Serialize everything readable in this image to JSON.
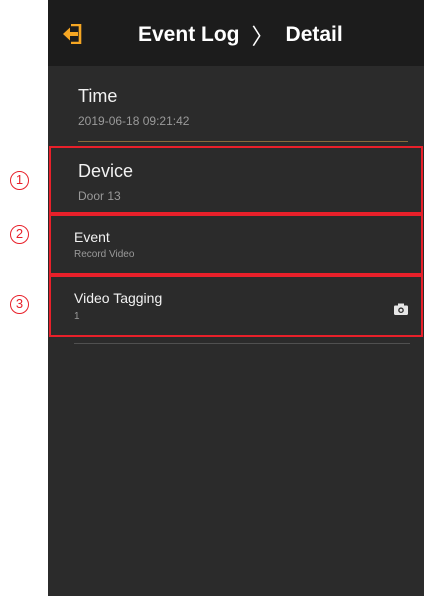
{
  "header": {
    "title": "Event Log",
    "separator": "〉",
    "subtitle": "Detail"
  },
  "fields": {
    "time": {
      "label": "Time",
      "value": "2019-06-18 09:21:42"
    },
    "device": {
      "label": "Device",
      "value": "Door 13"
    },
    "event": {
      "label": "Event",
      "value": "Record Video"
    },
    "video_tagging": {
      "label": "Video Tagging",
      "value": "1"
    }
  },
  "callouts": [
    "1",
    "2",
    "3"
  ],
  "icons": {
    "back": "back-exit-icon",
    "camera": "camera-icon"
  },
  "colors": {
    "background": "#2b2b2b",
    "header": "#1c1c1c",
    "accent_orange": "#f5a623",
    "callout_red": "#e8202a"
  }
}
